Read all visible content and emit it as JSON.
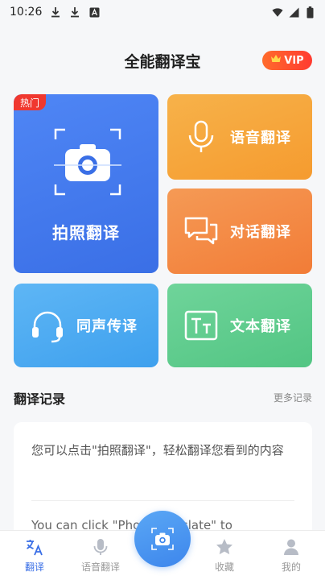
{
  "status_bar": {
    "time": "10:26",
    "icons": [
      "download-icon",
      "download-icon",
      "notification-a-icon",
      "wifi-icon",
      "signal-icon",
      "battery-icon"
    ]
  },
  "header": {
    "title": "全能翻译宝",
    "vip_label": "VIP",
    "vip_icon": "crown-icon"
  },
  "cards": {
    "photo": {
      "label": "拍照翻译",
      "tag": "热门",
      "icon": "camera-scan-icon"
    },
    "voice": {
      "label": "语音翻译",
      "icon": "microphone-icon"
    },
    "dialog": {
      "label": "对话翻译",
      "icon": "chat-bubbles-icon"
    },
    "simul": {
      "label": "同声传译",
      "icon": "headset-icon"
    },
    "text": {
      "label": "文本翻译",
      "icon": "text-tt-icon"
    }
  },
  "records": {
    "title": "翻译记录",
    "more": "更多记录",
    "cn_hint": "您可以点击\"拍照翻译\"，轻松翻译您看到的内容",
    "en_hint": "You can click \"Photo Translate\" to"
  },
  "bottom_nav": {
    "items": [
      {
        "label": "翻译",
        "icon": "translate-icon",
        "active": true
      },
      {
        "label": "语音翻译",
        "icon": "microphone-icon",
        "active": false
      },
      {
        "label": "收藏",
        "icon": "star-icon",
        "active": false
      },
      {
        "label": "我的",
        "icon": "person-icon",
        "active": false
      }
    ],
    "center_icon": "camera-icon"
  },
  "colors": {
    "primary": "#3a6fe6",
    "orange": "#f59b2f",
    "deep_orange": "#f27c37",
    "light_blue": "#3ea0ee",
    "green": "#52c583",
    "hot_red": "#f0382f"
  }
}
